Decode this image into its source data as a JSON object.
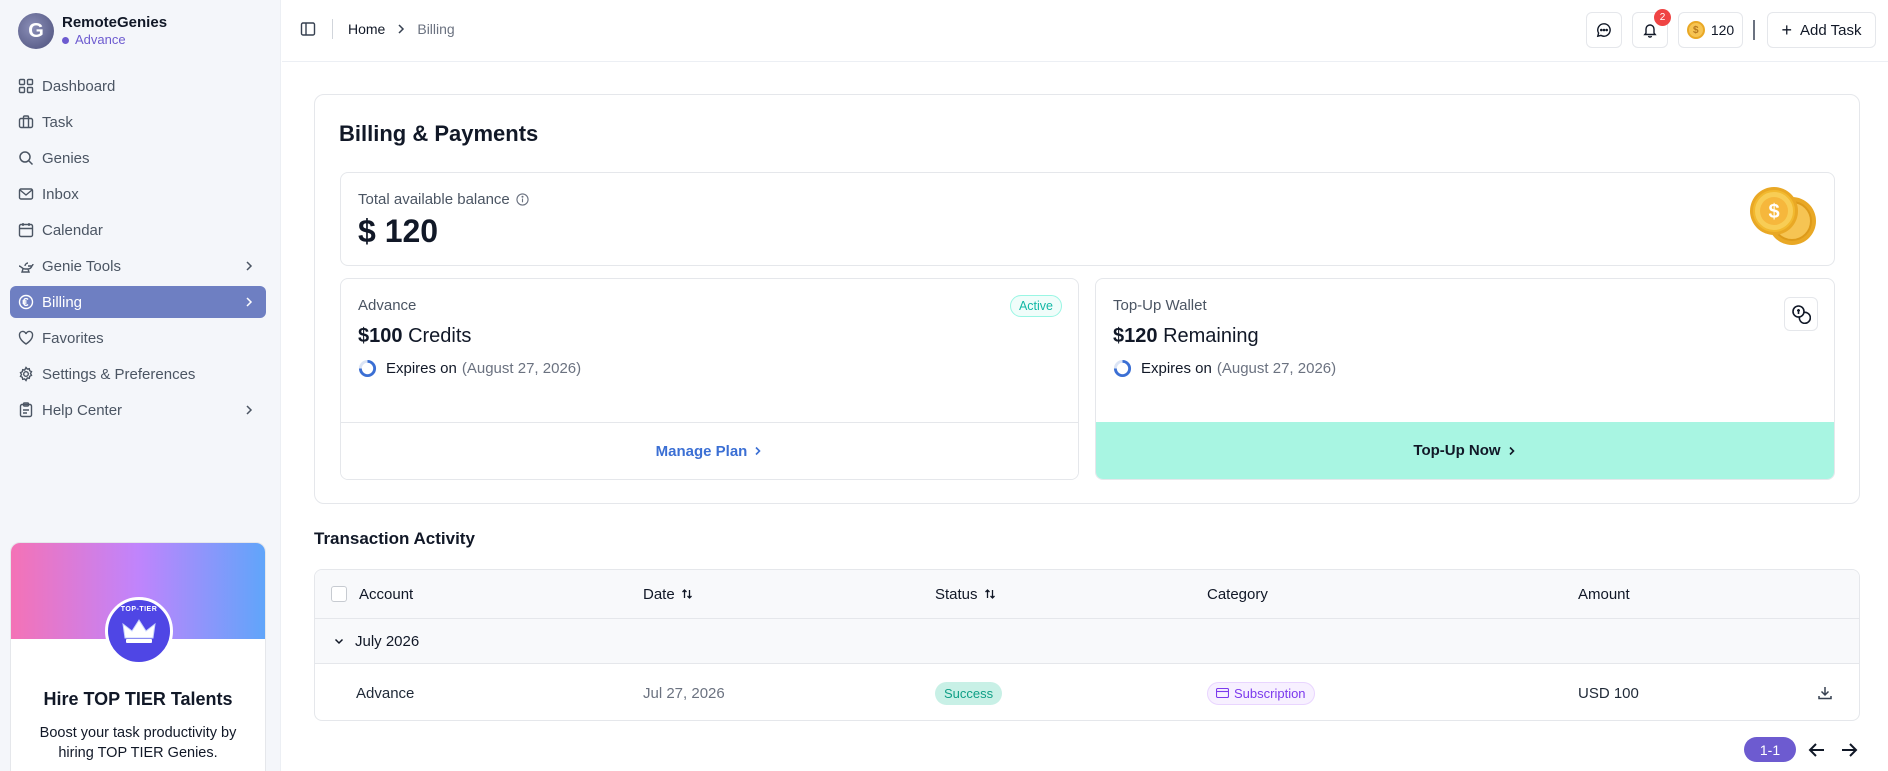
{
  "brand": {
    "name": "RemoteGenies",
    "plan": "Advance",
    "logo_letter": "G"
  },
  "sidebar": {
    "items": [
      {
        "label": "Dashboard",
        "icon": "grid-icon",
        "has_chevron": false,
        "active": false
      },
      {
        "label": "Task",
        "icon": "briefcase-icon",
        "has_chevron": false,
        "active": false
      },
      {
        "label": "Genies",
        "icon": "search-icon",
        "has_chevron": false,
        "active": false
      },
      {
        "label": "Inbox",
        "icon": "mail-icon",
        "has_chevron": false,
        "active": false
      },
      {
        "label": "Calendar",
        "icon": "calendar-icon",
        "has_chevron": false,
        "active": false
      },
      {
        "label": "Genie Tools",
        "icon": "lamp-icon",
        "has_chevron": true,
        "active": false
      },
      {
        "label": "Billing",
        "icon": "currency-icon",
        "has_chevron": true,
        "active": true
      },
      {
        "label": "Favorites",
        "icon": "heart-icon",
        "has_chevron": false,
        "active": false
      },
      {
        "label": "Settings & Preferences",
        "icon": "gear-icon",
        "has_chevron": false,
        "active": false
      },
      {
        "label": "Help Center",
        "icon": "clipboard-icon",
        "has_chevron": true,
        "active": false
      }
    ],
    "promo": {
      "badge_text": "TOP-TIER",
      "title": "Hire TOP TIER Talents",
      "description": "Boost your task productivity by hiring TOP TIER Genies."
    }
  },
  "header": {
    "breadcrumb": {
      "home": "Home",
      "current": "Billing"
    },
    "notification_count": "2",
    "coin_balance": "120",
    "add_task_label": "Add Task"
  },
  "billing": {
    "title": "Billing & Payments",
    "balance_label": "Total available balance",
    "balance_value": "$ 120",
    "plan": {
      "label": "Advance",
      "status": "Active",
      "amount": "$100",
      "amount_suffix": "Credits",
      "expires_label": "Expires on",
      "expires_date": "(August 27, 2026)",
      "action": "Manage Plan"
    },
    "wallet": {
      "label": "Top-Up Wallet",
      "amount": "$120",
      "amount_suffix": "Remaining",
      "expires_label": "Expires on",
      "expires_date": "(August 27, 2026)",
      "action": "Top-Up Now"
    }
  },
  "transactions": {
    "title": "Transaction Activity",
    "columns": {
      "account": "Account",
      "date": "Date",
      "status": "Status",
      "category": "Category",
      "amount": "Amount"
    },
    "group": "July 2026",
    "rows": [
      {
        "account": "Advance",
        "date": "Jul 27, 2026",
        "status": "Success",
        "category": "Subscription",
        "amount": "USD 100"
      }
    ],
    "pagination": "1-1"
  },
  "colors": {
    "accent": "#6d5bd0",
    "active_nav": "#6e7fc2",
    "cta": "#a8f5e2",
    "link": "#3b6fd4",
    "success": "#0f9f86"
  }
}
